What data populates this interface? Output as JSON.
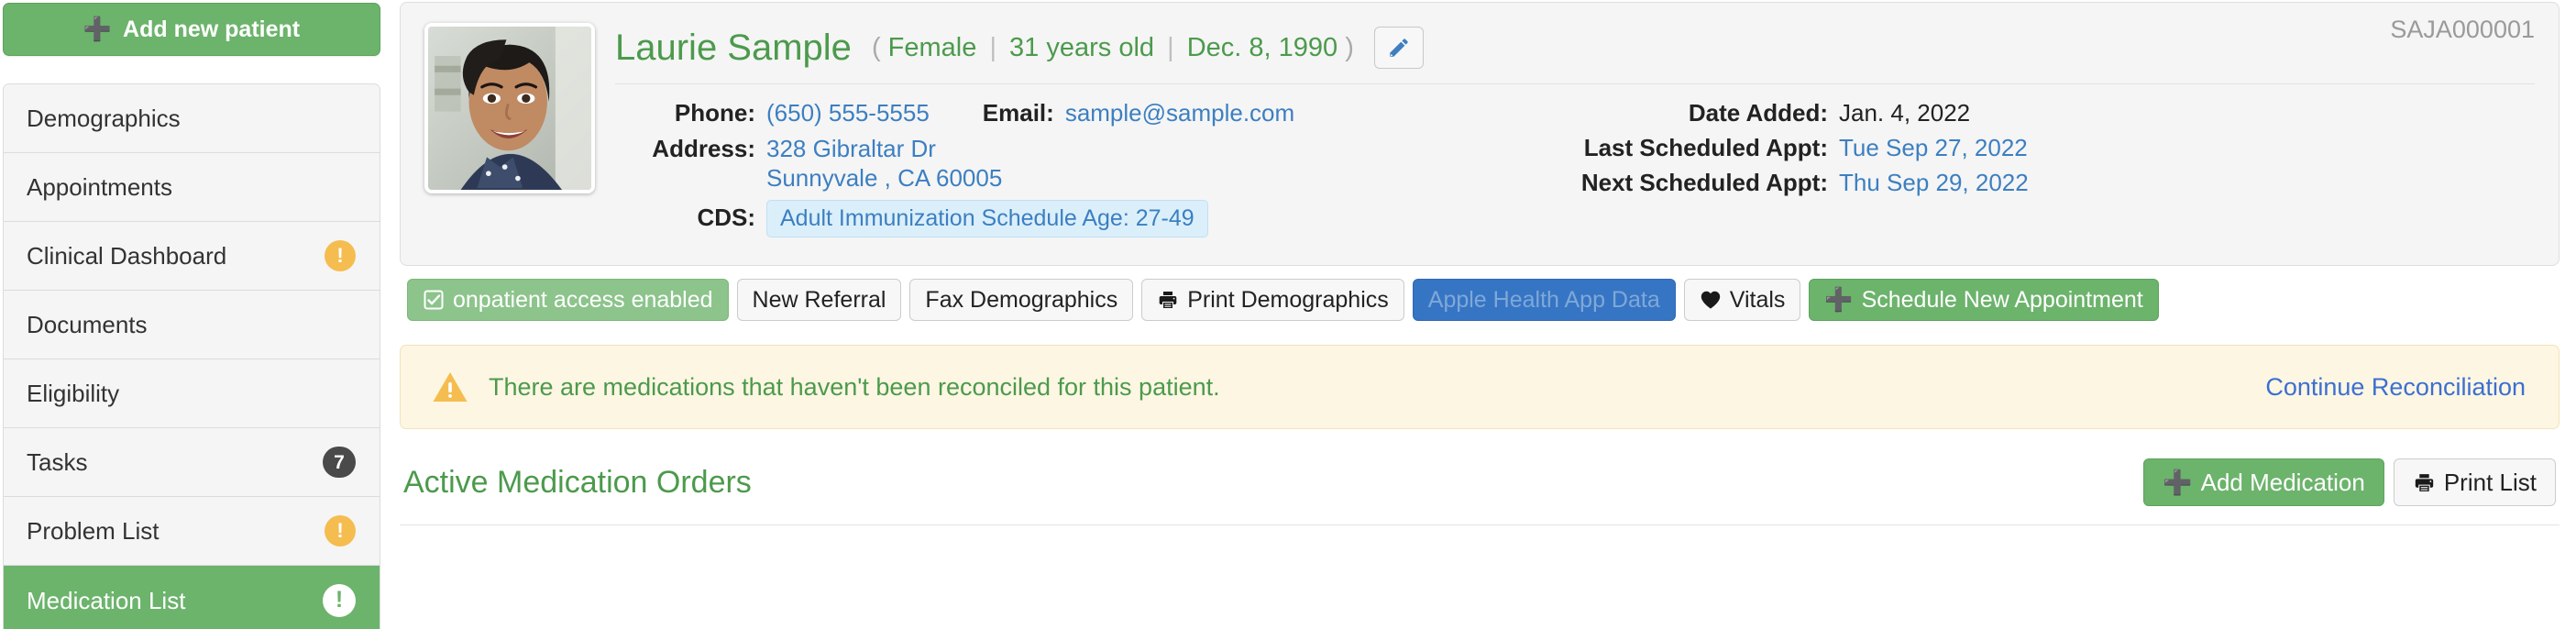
{
  "sidebar": {
    "add_patient": {
      "label": "Add new patient",
      "icon": "plus-icon"
    },
    "items": [
      {
        "label": "Demographics",
        "badge": null,
        "badge_type": "none",
        "active": false
      },
      {
        "label": "Appointments",
        "badge": null,
        "badge_type": "none",
        "active": false
      },
      {
        "label": "Clinical Dashboard",
        "badge": "!",
        "badge_type": "warn",
        "active": false
      },
      {
        "label": "Documents",
        "badge": null,
        "badge_type": "none",
        "active": false
      },
      {
        "label": "Eligibility",
        "badge": null,
        "badge_type": "none",
        "active": false
      },
      {
        "label": "Tasks",
        "badge": "7",
        "badge_type": "count",
        "active": false
      },
      {
        "label": "Problem List",
        "badge": "!",
        "badge_type": "warn",
        "active": false
      },
      {
        "label": "Medication List",
        "badge": "!",
        "badge_type": "warn-white",
        "active": true
      }
    ]
  },
  "patient": {
    "name": "Laurie Sample",
    "paren_open": "(",
    "paren_close": ")",
    "sex": "Female",
    "age": "31 years old",
    "dob": "Dec. 8, 1990",
    "separator": "|",
    "patient_id": "SAJA000001",
    "edit_icon": "pencil-icon",
    "avatar_alt": "patient-photo",
    "fields": {
      "phone_label": "Phone:",
      "phone_value": "(650) 555-5555",
      "email_label": "Email:",
      "email_value": "sample@sample.com",
      "address_label": "Address:",
      "address_line1": "328 Gibraltar Dr",
      "address_line2": "Sunnyvale , CA 60005",
      "cds_label": "CDS:",
      "cds_value": "Adult Immunization Schedule Age: 27-49",
      "date_added_label": "Date Added:",
      "date_added_value": "Jan. 4, 2022",
      "last_appt_label": "Last Scheduled Appt:",
      "last_appt_value": "Tue Sep 27, 2022",
      "next_appt_label": "Next Scheduled Appt:",
      "next_appt_value": "Thu Sep 29, 2022"
    }
  },
  "actions": [
    {
      "label": "onpatient access enabled",
      "style": "success-soft",
      "icon": "checkbox-checked-icon"
    },
    {
      "label": "New Referral",
      "style": "default",
      "icon": null
    },
    {
      "label": "Fax Demographics",
      "style": "default",
      "icon": null
    },
    {
      "label": "Print Demographics",
      "style": "default",
      "icon": "printer-icon"
    },
    {
      "label": "Apple Health App Data",
      "style": "primary",
      "icon": null
    },
    {
      "label": "Vitals",
      "style": "default",
      "icon": "heart-icon"
    },
    {
      "label": "Schedule New Appointment",
      "style": "green",
      "icon": "plus-icon"
    }
  ],
  "alert": {
    "icon": "warning-triangle-icon",
    "message": "There are medications that haven't been reconciled for this patient.",
    "action_label": "Continue Reconciliation"
  },
  "section": {
    "title": "Active Medication Orders",
    "buttons": [
      {
        "label": "Add Medication",
        "style": "green",
        "icon": "plus-icon"
      },
      {
        "label": "Print List",
        "style": "default",
        "icon": "printer-icon"
      }
    ]
  },
  "colors": {
    "brand_green": "#6cb36c",
    "title_green": "#4c9a4c",
    "link_blue": "#3c7fc1",
    "primary_blue": "#3675c4",
    "warn_amber": "#f5bd4f",
    "alert_bg": "#fdf6e3",
    "panel_bg": "#f5f5f5"
  }
}
